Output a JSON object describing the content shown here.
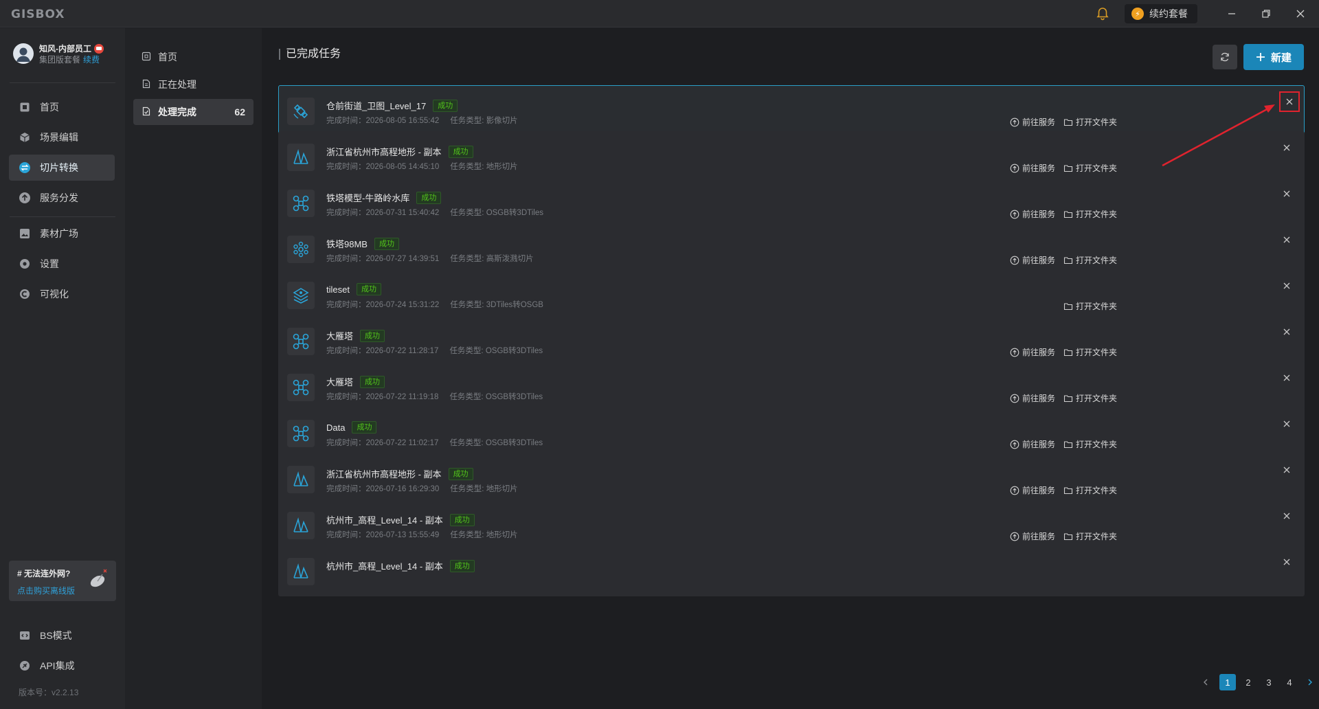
{
  "app": {
    "logo": "GISBOX",
    "renew_label": "续约套餐",
    "version": "版本号：v2.2.13"
  },
  "user": {
    "name": "知风-内部员工",
    "plan": "集团版套餐",
    "renew_link": "续费"
  },
  "leftnav": {
    "items": [
      {
        "label": "首页",
        "icon": "home-icon"
      },
      {
        "label": "场景编辑",
        "icon": "cube-icon"
      },
      {
        "label": "切片转换",
        "icon": "convert-icon"
      },
      {
        "label": "服务分发",
        "icon": "upload-icon"
      },
      {
        "label": "素材广场",
        "icon": "image-icon"
      },
      {
        "label": "设置",
        "icon": "gear-icon"
      },
      {
        "label": "可视化",
        "icon": "visual-icon"
      }
    ],
    "bottom_items": [
      {
        "label": "BS模式",
        "icon": "code-icon"
      },
      {
        "label": "API集成",
        "icon": "api-icon"
      }
    ],
    "promo": {
      "title": "# 无法连外网?",
      "link": "点击购买离线版"
    }
  },
  "subnav": {
    "items": [
      {
        "label": "首页"
      },
      {
        "label": "正在处理"
      },
      {
        "label": "处理完成",
        "count": "62"
      }
    ]
  },
  "main": {
    "title": "已完成任务",
    "new_label": "新建",
    "status_label": "成功",
    "time_prefix": "完成时间：",
    "type_prefix": "任务类型: ",
    "action_service": "前往服务",
    "action_folder": "打开文件夹",
    "tasks": [
      {
        "name": "仓前街道_卫图_Level_17",
        "time": "2026-08-05 16:55:42",
        "type": "影像切片",
        "icon": "satellite-icon",
        "has_service": true
      },
      {
        "name": "浙江省杭州市高程地形 - 副本",
        "time": "2026-08-05 14:45:10",
        "type": "地形切片",
        "icon": "terrain-icon",
        "has_service": true
      },
      {
        "name": "铁塔模型-牛路岭水库",
        "time": "2026-07-31 15:40:42",
        "type": "OSGB转3DTiles",
        "icon": "drone-icon",
        "has_service": true
      },
      {
        "name": "铁塔98MB",
        "time": "2026-07-27 14:39:51",
        "type": "高斯泼溅切片",
        "icon": "splat-icon",
        "has_service": true
      },
      {
        "name": "tileset",
        "time": "2026-07-24 15:31:22",
        "type": "3DTiles转OSGB",
        "icon": "tileset-icon",
        "has_service": false
      },
      {
        "name": "大雁塔",
        "time": "2026-07-22 11:28:17",
        "type": "OSGB转3DTiles",
        "icon": "drone-icon",
        "has_service": true
      },
      {
        "name": "大雁塔",
        "time": "2026-07-22 11:19:18",
        "type": "OSGB转3DTiles",
        "icon": "drone-icon",
        "has_service": true
      },
      {
        "name": "Data",
        "time": "2026-07-22 11:02:17",
        "type": "OSGB转3DTiles",
        "icon": "drone-icon",
        "has_service": true
      },
      {
        "name": "浙江省杭州市高程地形 - 副本",
        "time": "2026-07-16 16:29:30",
        "type": "地形切片",
        "icon": "terrain-icon",
        "has_service": true
      },
      {
        "name": "杭州市_高程_Level_14 - 副本",
        "time": "2026-07-13 15:55:49",
        "type": "地形切片",
        "icon": "terrain-icon",
        "has_service": true
      },
      {
        "name": "杭州市_高程_Level_14 - 副本",
        "time": "",
        "type": "",
        "icon": "terrain-icon",
        "has_service": true
      }
    ]
  },
  "pagination": {
    "pages": [
      "1",
      "2",
      "3",
      "4"
    ],
    "current": "1"
  },
  "colors": {
    "accent": "#1b86b8",
    "success": "#52c41a",
    "highlight": "#e0232e"
  }
}
